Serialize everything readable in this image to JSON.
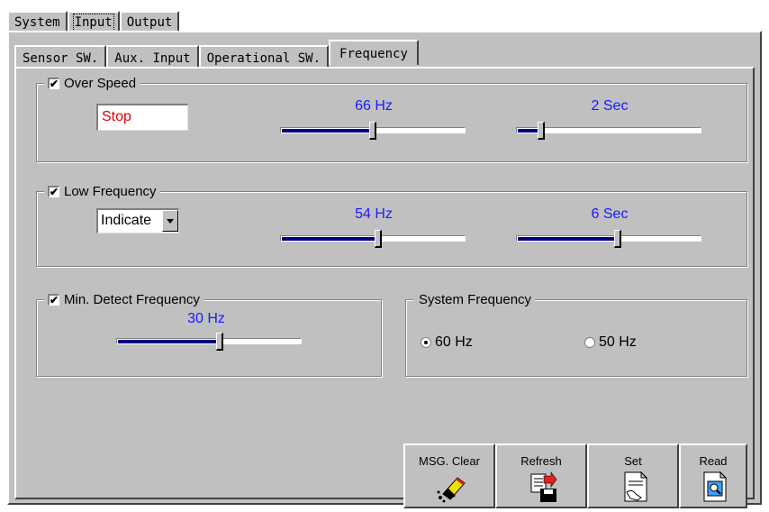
{
  "top_tabs": [
    "System",
    "Input",
    "Output"
  ],
  "sub_tabs": [
    "Sensor SW.",
    "Aux. Input",
    "Operational SW.",
    "Frequency"
  ],
  "over_speed": {
    "label": "Over Speed",
    "checked": true,
    "status_value": "Stop",
    "freq_label": "66 Hz",
    "freq_level": 0.5,
    "time_label": "2 Sec",
    "time_level": 0.12
  },
  "low_frequency": {
    "label": "Low Frequency",
    "checked": true,
    "mode_value": "Indicate",
    "freq_label": "54 Hz",
    "freq_level": 0.53,
    "time_label": "6 Sec",
    "time_level": 0.55
  },
  "min_detect": {
    "label": "Min. Detect Frequency",
    "checked": true,
    "freq_label": "30 Hz",
    "freq_level": 0.56
  },
  "system_frequency": {
    "label": "System Frequency",
    "options": [
      "60 Hz",
      "50 Hz"
    ],
    "selected": "60 Hz"
  },
  "buttons": {
    "msg_clear": "MSG. Clear",
    "refresh": "Refresh",
    "set": "Set",
    "read": "Read"
  },
  "check_mark": "✔",
  "colors": {
    "value_text": "#1a1aff",
    "status_text": "#e00000",
    "slider_fill": "#000080",
    "panel": "#c0c0c0"
  },
  "icons": [
    "eraser-icon",
    "refresh-save-icon",
    "set-document-icon",
    "read-document-icon"
  ]
}
